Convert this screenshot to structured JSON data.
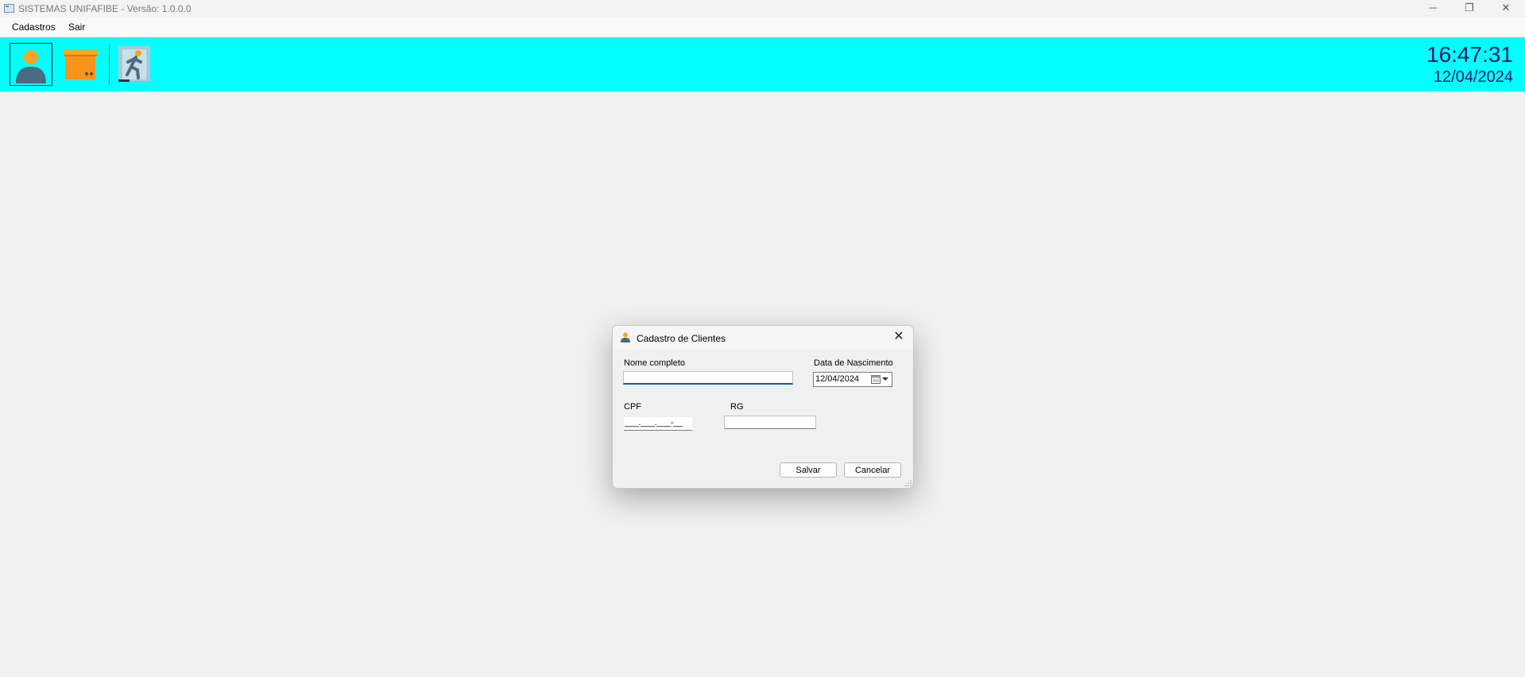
{
  "window": {
    "title": "SISTEMAS UNIFAFIBE - Versão: 1.0.0.0",
    "controls": {
      "minimize": "─",
      "restore": "❐",
      "close": "✕"
    }
  },
  "menu": [
    {
      "label": "Cadastros"
    },
    {
      "label": "Sair"
    }
  ],
  "toolbar": {
    "buttons": [
      {
        "icon": "person-icon",
        "active": true
      },
      {
        "icon": "box-icon",
        "active": false
      },
      {
        "icon": "exit-running-man-icon",
        "active": false
      }
    ],
    "background": "#00ffff"
  },
  "clock": {
    "time": "16:47:31",
    "date": "12/04/2024"
  },
  "dialog": {
    "title": "Cadastro de Clientes",
    "close_glyph": "✕",
    "fields": {
      "nome": {
        "label": "Nome completo",
        "value": ""
      },
      "nascimento": {
        "label": "Data de Nascimento",
        "value": "12/04/2024"
      },
      "cpf": {
        "label": "CPF",
        "mask": "___.___.___-__"
      },
      "rg": {
        "label": "RG",
        "value": ""
      }
    },
    "buttons": {
      "save": "Salvar",
      "cancel": "Cancelar"
    }
  },
  "colors": {
    "accent": "#005fb8",
    "clock_text": "#0c1c6a",
    "icon_orange": "#f5a623",
    "icon_slate": "#4d6a80"
  }
}
